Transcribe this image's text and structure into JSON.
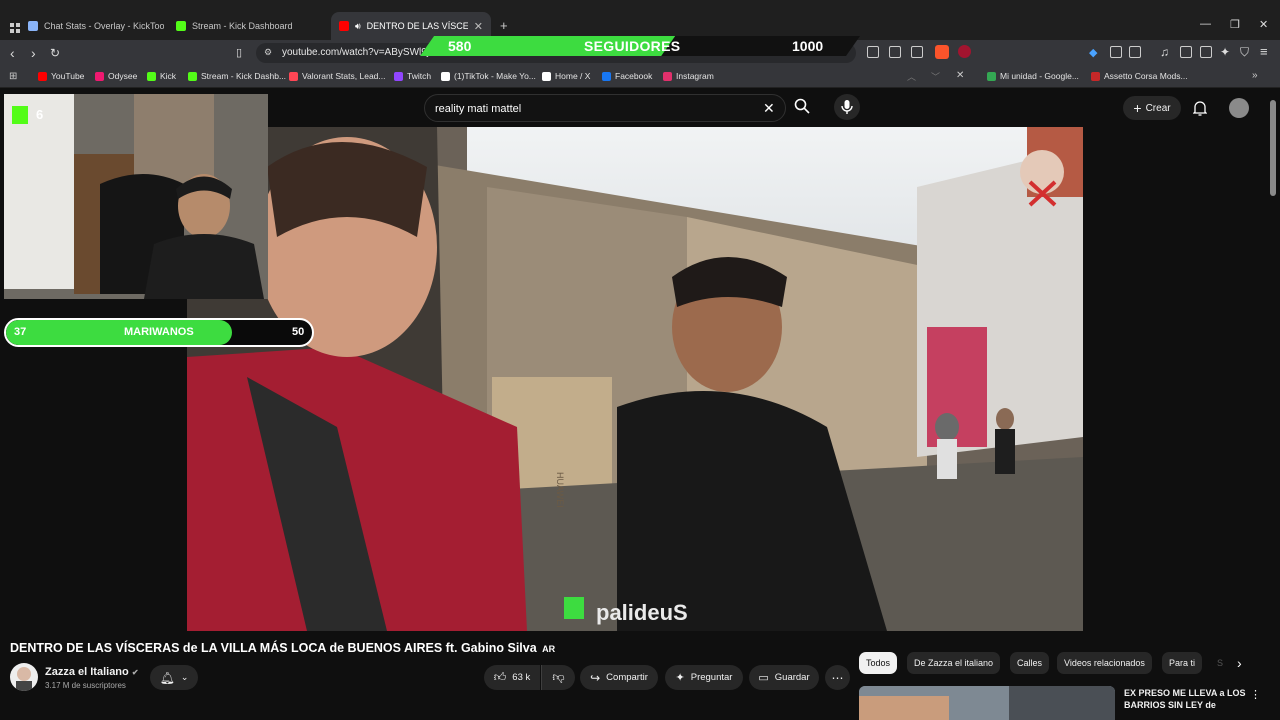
{
  "browser": {
    "tabs": [
      {
        "label": "Chat Stats - Overlay - KickTools",
        "color": "#8ab4f8"
      },
      {
        "label": "Stream - Kick Dashboard",
        "color": "#53fc18"
      },
      {
        "label": "DENTRO DE LAS VÍSCERAS de",
        "color": "#ff0000"
      }
    ],
    "new_tab": "+",
    "url": "youtube.com/watch?v=ABySWl9j",
    "bookmarks": [
      {
        "label": "YouTube",
        "color": "#ff0000"
      },
      {
        "label": "Odysee",
        "color": "#ef1970"
      },
      {
        "label": "Kick",
        "color": "#53fc18"
      },
      {
        "label": "Stream - Kick Dashb...",
        "color": "#53fc18"
      },
      {
        "label": "Valorant Stats, Lead...",
        "color": "#ff4655"
      },
      {
        "label": "Twitch",
        "color": "#9146ff"
      },
      {
        "label": "(1)TikTok - Make Yo...",
        "color": "#ffffff"
      },
      {
        "label": "Home / X",
        "color": "#ffffff"
      },
      {
        "label": "Facebook",
        "color": "#1877f2"
      },
      {
        "label": "Instagram",
        "color": "#e1306c"
      },
      {
        "label": "Mi unidad - Google...",
        "color": "#34a853"
      },
      {
        "label": "Assetto Corsa Mods...",
        "color": "#c62828"
      }
    ]
  },
  "overlay": {
    "followers": {
      "current": "580",
      "label": "SEGUIDORES",
      "goal": "1000",
      "progress": 0.58
    },
    "goal_bar": {
      "current": "37",
      "label": "MARIWANOS",
      "goal": "50",
      "progress": 0.74
    },
    "kick_badge": "6"
  },
  "youtube": {
    "search_query": "reality mati mattel",
    "create_label": "Crear",
    "video": {
      "title": "DENTRO DE LAS VÍSCERAS de LA VILLA MÁS LOCA de BUENOS AIRES ft. Gabino Silva",
      "country": "AR",
      "watermark": "palideuS",
      "wall_brand": "HUAWEI"
    },
    "channel": {
      "name": "Zazza el Italiano",
      "subscribers": "3.17 M de suscriptores"
    },
    "actions": {
      "likes": "63 k",
      "share": "Compartir",
      "ask": "Preguntar",
      "save": "Guardar"
    },
    "chips": [
      "Todos",
      "De Zazza el italiano",
      "Calles",
      "Videos relacionados",
      "Para ti",
      "S"
    ],
    "related": {
      "title": "EX PRESO ME LLEVA a LOS BARRIOS SIN LEY de"
    }
  }
}
